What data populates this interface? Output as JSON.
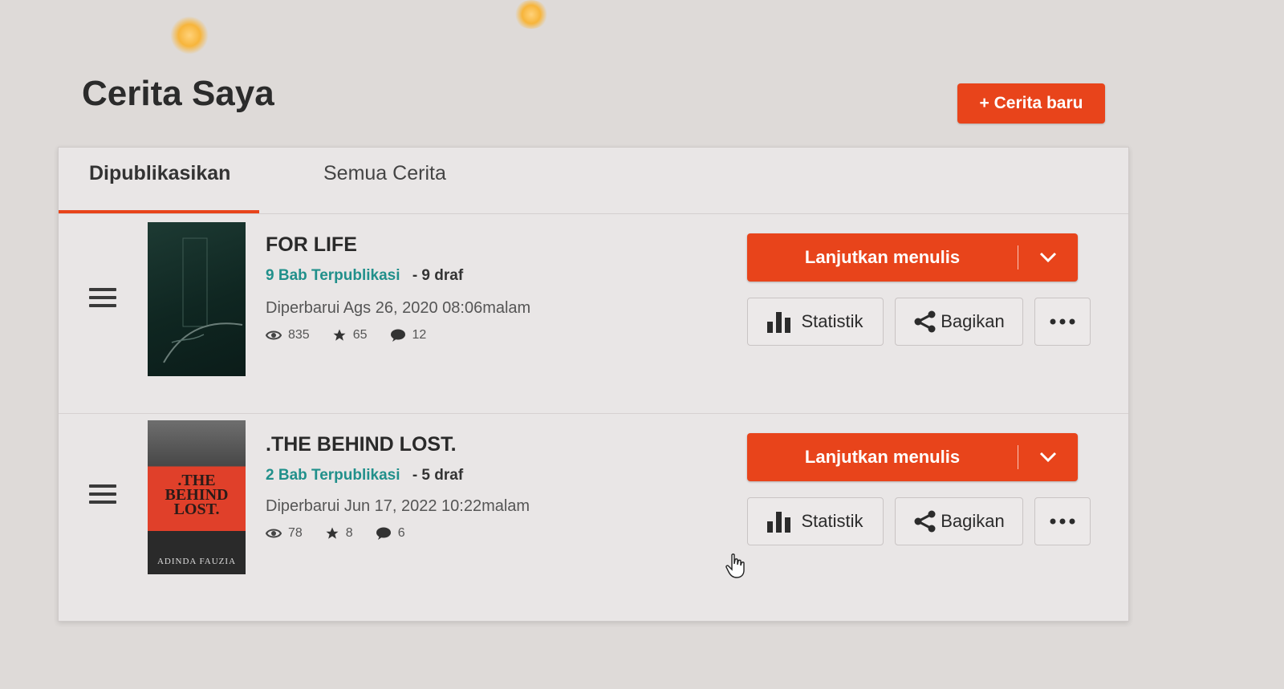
{
  "page": {
    "title": "Cerita Saya",
    "new_story_label": "+ Cerita baru"
  },
  "tabs": [
    {
      "label": "Dipublikasikan",
      "active": true
    },
    {
      "label": "Semua Cerita",
      "active": false
    }
  ],
  "stories": [
    {
      "title": "FOR LIFE",
      "published": "9 Bab Terpublikasi",
      "drafts": "- 9 draf",
      "updated": "Diperbarui Ags 26, 2020 08:06malam",
      "reads": "835",
      "votes": "65",
      "comments": "12",
      "continue_label": "Lanjutkan menulis",
      "stats_label": "Statistik",
      "share_label": "Bagikan"
    },
    {
      "title": ".THE BEHIND LOST.",
      "published": "2 Bab Terpublikasi",
      "drafts": "- 5 draf",
      "updated": "Diperbarui Jun 17, 2022 10:22malam",
      "reads": "78",
      "votes": "8",
      "comments": "6",
      "continue_label": "Lanjutkan menulis",
      "stats_label": "Statistik",
      "share_label": "Bagikan",
      "cover_text": ".THE BEHIND LOST.",
      "cover_author": "ADINDA FAUZIA"
    }
  ],
  "icons": {
    "reads": "eye-icon",
    "votes": "star-icon",
    "comments": "comment-icon",
    "stats": "bar-chart-icon",
    "share": "share-icon",
    "more": "ellipsis-icon",
    "continue_menu": "chevron-down-icon",
    "drag": "hamburger-icon"
  },
  "colors": {
    "accent": "#e8441b",
    "link": "#21908b"
  }
}
